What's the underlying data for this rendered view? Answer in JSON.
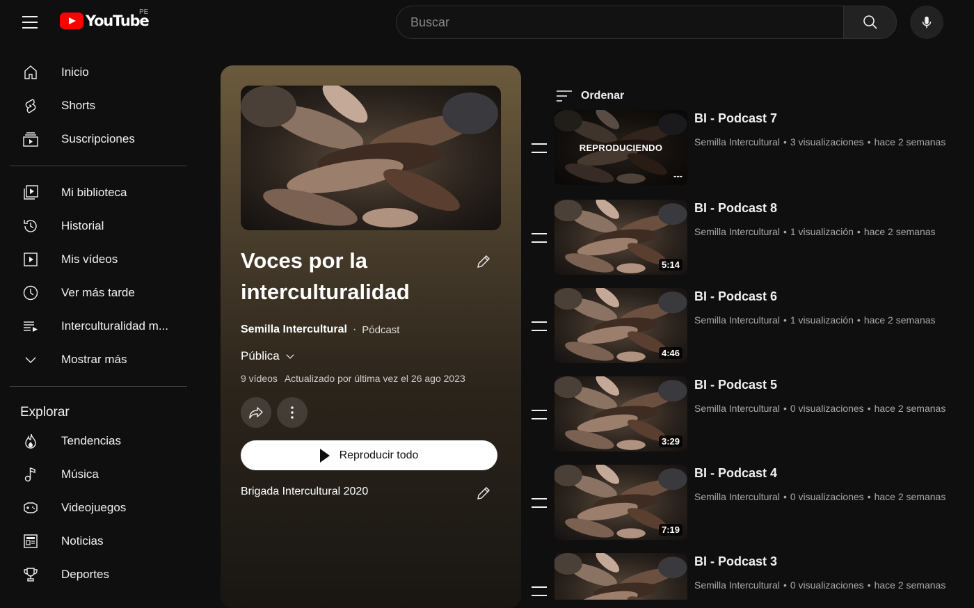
{
  "header": {
    "logo_text": "YouTube",
    "country": "PE",
    "search_placeholder": "Buscar"
  },
  "sidebar": {
    "main": [
      {
        "label": "Inicio",
        "icon": "home-icon"
      },
      {
        "label": "Shorts",
        "icon": "shorts-icon"
      },
      {
        "label": "Suscripciones",
        "icon": "subscriptions-icon"
      }
    ],
    "library": [
      {
        "label": "Mi biblioteca",
        "icon": "library-icon"
      },
      {
        "label": "Historial",
        "icon": "history-icon"
      },
      {
        "label": "Mis vídeos",
        "icon": "my-videos-icon"
      },
      {
        "label": "Ver más tarde",
        "icon": "watch-later-icon"
      },
      {
        "label": "Interculturalidad m...",
        "icon": "playlist-icon"
      },
      {
        "label": "Mostrar más",
        "icon": "chevron-down-icon"
      }
    ],
    "explore_heading": "Explorar",
    "explore": [
      {
        "label": "Tendencias",
        "icon": "trending-icon"
      },
      {
        "label": "Música",
        "icon": "music-icon"
      },
      {
        "label": "Videojuegos",
        "icon": "gaming-icon"
      },
      {
        "label": "Noticias",
        "icon": "news-icon"
      },
      {
        "label": "Deportes",
        "icon": "sports-icon"
      }
    ]
  },
  "playlist": {
    "title": "Voces por la interculturalidad",
    "owner": "Semilla Intercultural",
    "dot": "·",
    "type": "Pódcast",
    "privacy": "Pública",
    "video_count": "9 vídeos",
    "updated": "Actualizado por última vez el 26 ago 2023",
    "play_all": "Reproducir todo",
    "description": "Brigada Intercultural 2020"
  },
  "sort_label": "Ordenar",
  "videos": [
    {
      "title": "BI - Podcast 7",
      "channel": "Semilla Intercultural",
      "views": "3 visualizaciones",
      "age": "hace 2 semanas",
      "playing": "REPRODUCIENDO",
      "duration": "---"
    },
    {
      "title": "BI - Podcast 8",
      "channel": "Semilla Intercultural",
      "views": "1 visualización",
      "age": "hace 2 semanas",
      "duration": "5:14"
    },
    {
      "title": "BI - Podcast 6",
      "channel": "Semilla Intercultural",
      "views": "1 visualización",
      "age": "hace 2 semanas",
      "duration": "4:46"
    },
    {
      "title": "BI - Podcast 5",
      "channel": "Semilla Intercultural",
      "views": "0 visualizaciones",
      "age": "hace 2 semanas",
      "duration": "3:29"
    },
    {
      "title": "BI - Podcast 4",
      "channel": "Semilla Intercultural",
      "views": "0 visualizaciones",
      "age": "hace 2 semanas",
      "duration": "7:19"
    },
    {
      "title": "BI - Podcast 3",
      "channel": "Semilla Intercultural",
      "views": "0 visualizaciones",
      "age": "hace 2 semanas",
      "duration": ""
    }
  ],
  "colors": {
    "background": "#0f0f0f",
    "brand_red": "#ff0000",
    "panel_top": "#6b5a3c",
    "meta_text": "#aaaaaa"
  }
}
